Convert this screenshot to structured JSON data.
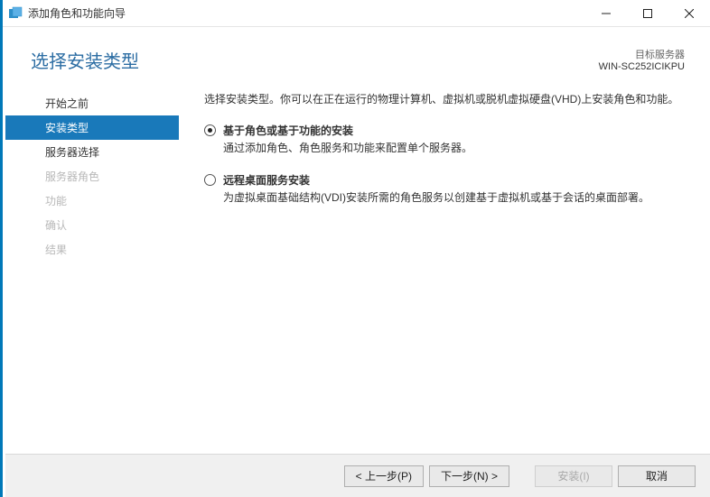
{
  "window": {
    "title": "添加角色和功能向导"
  },
  "header": {
    "title": "选择安装类型",
    "target_label": "目标服务器",
    "target_name": "WIN-SC252ICIKPU"
  },
  "sidebar": {
    "items": [
      {
        "label": "开始之前",
        "state": "enabled"
      },
      {
        "label": "安装类型",
        "state": "selected"
      },
      {
        "label": "服务器选择",
        "state": "enabled"
      },
      {
        "label": "服务器角色",
        "state": "disabled"
      },
      {
        "label": "功能",
        "state": "disabled"
      },
      {
        "label": "确认",
        "state": "disabled"
      },
      {
        "label": "结果",
        "state": "disabled"
      }
    ]
  },
  "main": {
    "intro": "选择安装类型。你可以在正在运行的物理计算机、虚拟机或脱机虚拟硬盘(VHD)上安装角色和功能。",
    "options": [
      {
        "title": "基于角色或基于功能的安装",
        "desc": "通过添加角色、角色服务和功能来配置单个服务器。",
        "checked": true
      },
      {
        "title": "远程桌面服务安装",
        "desc": "为虚拟桌面基础结构(VDI)安装所需的角色服务以创建基于虚拟机或基于会话的桌面部署。",
        "checked": false
      }
    ]
  },
  "footer": {
    "prev": "< 上一步(P)",
    "next": "下一步(N) >",
    "install": "安装(I)",
    "cancel": "取消"
  }
}
